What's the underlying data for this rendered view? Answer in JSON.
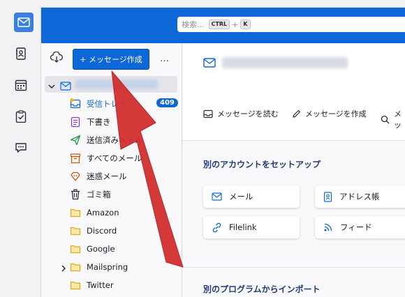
{
  "search": {
    "placeholder": "検索...",
    "shortcut_key1": "CTRL",
    "shortcut_plus": "+",
    "shortcut_key2": "K"
  },
  "spaces": [
    "mail-icon",
    "address-book-icon",
    "calendar-icon",
    "tasks-icon",
    "chat-icon"
  ],
  "folder_pane": {
    "new_message": "+  メッセージ作成",
    "more": "…",
    "folders": [
      {
        "label": "受信トレイ",
        "icon": "inbox-icon",
        "badge": "409"
      },
      {
        "label": "下書き",
        "icon": "drafts-icon"
      },
      {
        "label": "送信済みメール",
        "icon": "sent-icon"
      },
      {
        "label": "すべてのメール",
        "icon": "archive-icon"
      },
      {
        "label": "迷惑メール",
        "icon": "junk-icon"
      },
      {
        "label": "ゴミ箱",
        "icon": "trash-icon"
      },
      {
        "label": "Amazon",
        "icon": "folder-icon"
      },
      {
        "label": "Discord",
        "icon": "folder-icon"
      },
      {
        "label": "Google",
        "icon": "folder-icon"
      },
      {
        "label": "Mailspring",
        "icon": "folder-icon",
        "expandable": true
      },
      {
        "label": "Twitter",
        "icon": "folder-icon"
      }
    ]
  },
  "content": {
    "actions": {
      "read": "メッセージを読む",
      "compose": "メッセージを作成",
      "search": "メッ"
    },
    "setup_title": "別のアカウントをセットアップ",
    "cards": {
      "mail": "メール",
      "address_book": "アドレス帳",
      "filelink": "Filelink",
      "feed": "フィード"
    },
    "import_title": "別のプログラムからインポート"
  },
  "colors": {
    "accent": "#0e67d6",
    "arrow": "#d32f2f"
  }
}
